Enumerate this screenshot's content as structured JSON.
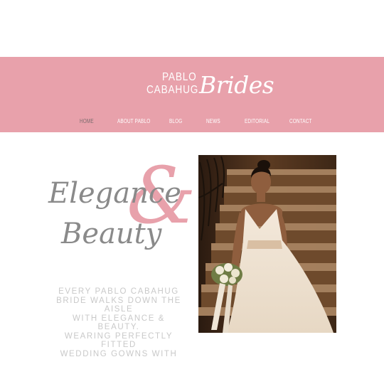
{
  "brand": {
    "first_name": "PABLO",
    "last_name": "CABAHUG",
    "script": "Brides",
    "accent_color": "#e8a1ab"
  },
  "nav": {
    "items": [
      {
        "label": "HOME",
        "active": true
      },
      {
        "label": "ABOUT PABLO"
      },
      {
        "label": "BLOG"
      },
      {
        "label": "NEWS"
      },
      {
        "label": "EDITORIAL"
      },
      {
        "label": "CONTACT"
      }
    ]
  },
  "hero": {
    "word1": "Elegance",
    "amp": "&",
    "word2": "Beauty",
    "blurb_lines": [
      "EVERY PABLO CABAHUG",
      "BRIDE WALKS DOWN THE AISLE",
      "WITH ELEGANCE & BEAUTY.",
      "WEARING PERFECTLY FITTED",
      "WEDDING GOWNS WITH"
    ]
  }
}
